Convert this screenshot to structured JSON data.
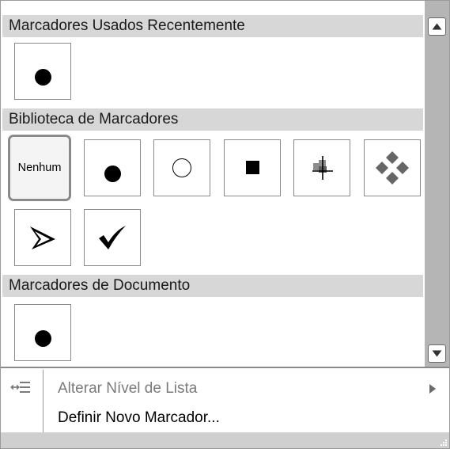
{
  "sections": {
    "recent": {
      "title": "Marcadores Usados Recentemente"
    },
    "library": {
      "title": "Biblioteca de Marcadores",
      "none_label": "Nenhum"
    },
    "document": {
      "title": "Marcadores de Documento"
    }
  },
  "menu": {
    "change_level": {
      "label": "Alterar Nível de Lista",
      "icon": "list-indent-icon",
      "enabled": false,
      "has_submenu": true
    },
    "define_new": {
      "label": "Definir Novo Marcador...",
      "enabled": true
    }
  },
  "colors": {
    "header_bg": "#d7d7d7",
    "scrollbar": "#b5b5b5",
    "disabled_text": "#7a7a7a"
  }
}
